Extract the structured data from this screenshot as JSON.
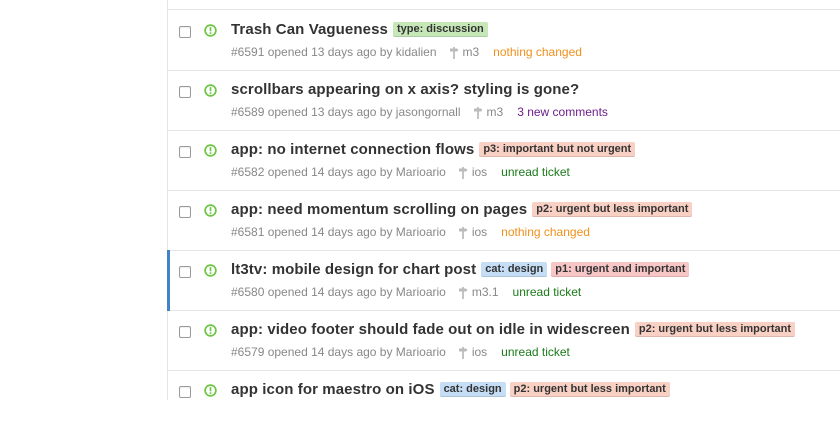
{
  "issues": [
    {
      "title": "Trash Can Vagueness",
      "labels": [
        {
          "text": "type: discussion",
          "color": "#c6e8b8"
        }
      ],
      "meta": "#6591 opened 13 days ago by kidalien",
      "milestone": "m3",
      "note": "nothing changed",
      "note_color": "#f0901c"
    },
    {
      "title": "scrollbars appearing on x axis? styling is gone?",
      "labels": [],
      "meta": "#6589 opened 13 days ago by jasongornall",
      "milestone": "m3",
      "note": "3 new comments",
      "note_color": "#6e1e8a"
    },
    {
      "title": "app: no internet connection flows",
      "labels": [
        {
          "text": "p3: important but not urgent",
          "color": "#f9d0c4"
        }
      ],
      "meta": "#6582 opened 14 days ago by Marioario",
      "milestone": "ios",
      "note": "unread ticket",
      "note_color": "#1a7a1a"
    },
    {
      "title": "app: need momentum scrolling on pages",
      "labels": [
        {
          "text": "p2: urgent but less important",
          "color": "#f9d0c4"
        }
      ],
      "meta": "#6581 opened 14 days ago by Marioario",
      "milestone": "ios",
      "note": "nothing changed",
      "note_color": "#f0901c"
    },
    {
      "title": "lt3tv: mobile design for chart post",
      "labels": [
        {
          "text": "cat: design",
          "color": "#c5def5"
        },
        {
          "text": "p1: urgent and important",
          "color": "#f7c6c7"
        }
      ],
      "meta": "#6580 opened 14 days ago by Marioario",
      "milestone": "m3.1",
      "note": "unread ticket",
      "note_color": "#1a7a1a"
    },
    {
      "title": "app: video footer should fade out on idle in widescreen",
      "labels": [
        {
          "text": "p2: urgent but less important",
          "color": "#f9d0c4"
        }
      ],
      "meta": "#6579 opened 14 days ago by Marioario",
      "milestone": "ios",
      "note": "unread ticket",
      "note_color": "#1a7a1a"
    },
    {
      "title": "app icon for maestro on iOS",
      "labels": [
        {
          "text": "cat: design",
          "color": "#c5def5"
        },
        {
          "text": "p2: urgent but less important",
          "color": "#f9d0c4"
        }
      ],
      "meta": "",
      "milestone": "",
      "note": "",
      "note_color": "#888888"
    }
  ],
  "colors": {
    "open_icon": "#6cc644",
    "accent": "#4183c4"
  },
  "icons": {
    "status": "issue-opened-icon",
    "milestone": "milestone-icon"
  }
}
